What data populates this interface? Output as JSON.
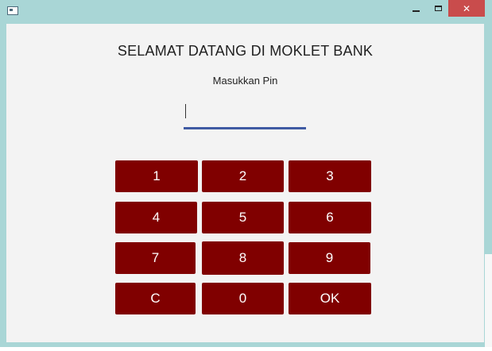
{
  "window": {
    "icon": "window-icon",
    "controls": {
      "minimize_icon": "minimize-icon",
      "maximize_icon": "maximize-icon",
      "close_icon": "close-icon",
      "close_glyph": "✕"
    }
  },
  "colors": {
    "frame": "#a9d6d6",
    "client_bg": "#f3f3f3",
    "keypad": "#800000",
    "key_text": "#ffffff",
    "input_underline": "#3f5aa3",
    "close_button": "#c94c4c"
  },
  "main": {
    "title": "SELAMAT DATANG DI MOKLET BANK",
    "pin_label": "Masukkan Pin",
    "pin_value": ""
  },
  "keypad": {
    "k1": "1",
    "k2": "2",
    "k3": "3",
    "k4": "4",
    "k5": "5",
    "k6": "6",
    "k7": "7",
    "k8": "8",
    "k9": "9",
    "clear": "C",
    "k0": "0",
    "ok": "OK"
  }
}
